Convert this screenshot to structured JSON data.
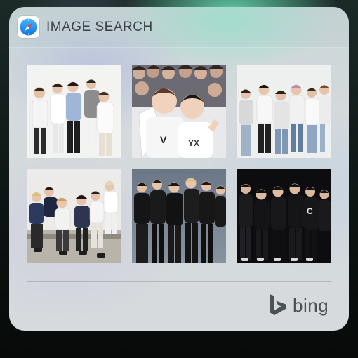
{
  "widget": {
    "title": "IMAGE SEARCH",
    "app_icon": "safari-compass-icon",
    "provider_label": "bing",
    "provider_icon": "bing-b-icon"
  },
  "results": [
    {
      "id": "result-1",
      "scene": "group of young men in white and grey outfits against white studio background"
    },
    {
      "id": "result-2",
      "scene": "close-up of two young men in front of crowd in graphic tees"
    },
    {
      "id": "result-3",
      "scene": "group in white sweaters and jeans against light background"
    },
    {
      "id": "result-4",
      "scene": "group seated on bench in casual outfits, light wall background"
    },
    {
      "id": "result-5",
      "scene": "group in black outfits and leather jackets against grey background"
    },
    {
      "id": "result-6",
      "scene": "group in black outfits and caps against dark background"
    }
  ],
  "colors": {
    "card": "#d3d9dc",
    "title_text": "#3c4244",
    "bing_text": "#4c5356",
    "accent_blue": "#1e8cf0"
  }
}
